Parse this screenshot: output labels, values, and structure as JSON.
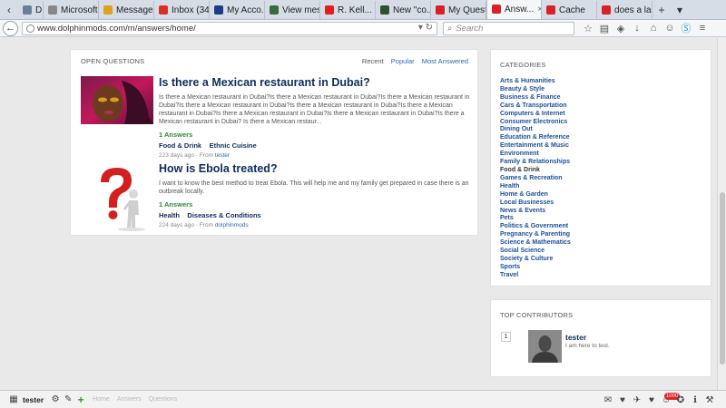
{
  "browser": {
    "tabs": [
      {
        "label": "D...",
        "favicon": "#6b7f9a"
      },
      {
        "label": "Microsoft Wo...",
        "favicon": "#888888"
      },
      {
        "label": "Message...",
        "favicon": "#e0a020"
      },
      {
        "label": "Inbox (34...",
        "favicon": "#d93025"
      },
      {
        "label": "My Acco...",
        "favicon": "#1a3c8a"
      },
      {
        "label": "View mes...",
        "favicon": "#3a6b3a"
      },
      {
        "label": "R. Kell...",
        "favicon": "#e02020"
      },
      {
        "label": "New \"co...",
        "favicon": "#2f4f2f"
      },
      {
        "label": "My Quest...",
        "favicon": "#d92027"
      },
      {
        "label": "Answ...",
        "favicon": "#d92027",
        "active": true
      },
      {
        "label": "Cache",
        "favicon": "#d92027"
      },
      {
        "label": "does a la...",
        "favicon": "#d92027"
      }
    ],
    "url": "www.dolphinmods.com/m/answers/home/",
    "search_placeholder": "Search"
  },
  "questions": {
    "heading": "OPEN QUESTIONS",
    "sort": {
      "recent": "Recent",
      "popular": "Popular",
      "most_answered": "Most Answered"
    },
    "items": [
      {
        "title": "Is there a Mexican restaurant in Dubai?",
        "text": "Is there a Mexican restaurant in Dubai?Is there a Mexican restaurant in Dubai?Is there a Mexican restaurant in Dubai?Is there a Mexican restaurant in Dubai?Is there a Mexican restaurant in Dubai?Is there a Mexican restaurant in Dubai?Is there a Mexican restaurant in Dubai?Is there a Mexican restaurant in Dubai?Is there a Mexican restaurant in Dubai? Is there a Mexican restaur...",
        "answers": "1 Answers",
        "category": "Food & Drink",
        "subcategory": "Ethnic Cuisine",
        "age": "223 days ago",
        "from_label": "From",
        "author": "tester"
      },
      {
        "title": "How is Ebola treated?",
        "text": "I want to know the best method to treat Ebola. This will help me and my family get prepared in case there is an outbreak locally.",
        "answers": "1 Answers",
        "category": "Health",
        "subcategory": "Diseases & Conditions",
        "age": "224 days ago",
        "from_label": "From",
        "author": "dolphinmods"
      }
    ]
  },
  "categories": {
    "heading": "CATEGORIES",
    "items": [
      "Arts & Humanities",
      "Beauty & Style",
      "Business & Finance",
      "Cars & Transportation",
      "Computers & Internet",
      "Consumer Electronics",
      "Dining Out",
      "Education & Reference",
      "Entertainment & Music",
      "Environment",
      "Family & Relationships",
      "Food & Drink",
      "Games & Recreation",
      "Health",
      "Home & Garden",
      "Local Businesses",
      "News & Events",
      "Pets",
      "Politics & Government",
      "Pregnancy & Parenting",
      "Science & Mathematics",
      "Social Science",
      "Society & Culture",
      "Sports",
      "Travel"
    ],
    "current": "Food & Drink"
  },
  "contributors": {
    "heading": "TOP CONTRIBUTORS",
    "items": [
      {
        "rank": "1",
        "name": "tester",
        "bio": "I am here to test."
      }
    ]
  },
  "bottombar": {
    "user": "tester",
    "breadcrumbs": [
      "Home",
      "Answers",
      "Questions"
    ],
    "notification_count": "1000"
  },
  "colors": {
    "link": "#2b6cb0",
    "title": "#0d2d5e",
    "answers_green": "#2e8b2e",
    "badge_red": "#d9242a"
  }
}
